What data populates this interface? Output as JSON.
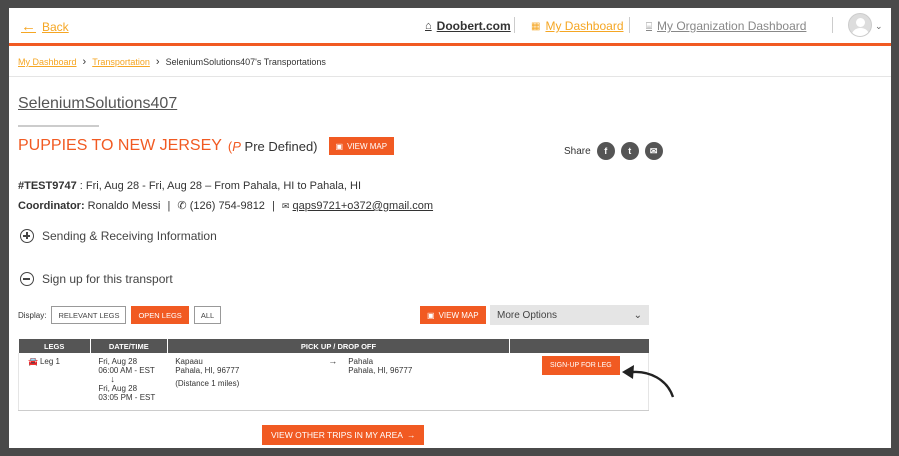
{
  "header": {
    "back_label": "Back",
    "doobert_label": "Doobert.com",
    "my_dashboard_label": "My Dashboard",
    "org_dashboard_label": "My Organization Dashboard"
  },
  "breadcrumb": {
    "items": [
      "My Dashboard",
      "Transportation"
    ],
    "current": "SeleniumSolutions407's Transportations"
  },
  "org": {
    "name": "SeleniumSolutions407"
  },
  "trip": {
    "title": "PUPPIES TO NEW JERSEY",
    "type_prefix": "(",
    "type_icon": "P",
    "type_label": " Pre Defined)",
    "view_map_label": "VIEW MAP",
    "share_label": "Share",
    "id": "#TEST9747",
    "summary": " : Fri, Aug 28 - Fri, Aug 28 – From Pahala, HI to Pahala, HI",
    "coordinator_label": "Coordinator:",
    "coordinator_name": " Ronaldo Messi",
    "phone": "(126) 754-9812",
    "email": "qaps9721+o372@gmail.com"
  },
  "sections": {
    "sending": "Sending & Receiving Information",
    "signup": "Sign up for this transport"
  },
  "filters": {
    "display_label": "Display:",
    "relevant": "RELEVANT LEGS",
    "open": "OPEN LEGS",
    "all": "ALL",
    "view_map_label": "VIEW MAP",
    "more_options": "More Options"
  },
  "table": {
    "headers": [
      "LEGS",
      "DATE/TIME",
      "PICK UP / DROP OFF",
      ""
    ],
    "rows": [
      {
        "leg": "Leg 1",
        "start_date": "Fri, Aug 28",
        "start_time": "06:00 AM - EST",
        "end_date": "Fri, Aug 28",
        "end_time": "03:05 PM - EST",
        "pickup_city": "Kapaau",
        "pickup_addr": "Pahala, HI, 96777",
        "distance": "(Distance 1 miles)",
        "dropoff_city": "Pahala",
        "dropoff_addr": "Pahala, HI, 96777",
        "signup_label": "SIGN-UP FOR LEG"
      }
    ]
  },
  "bottom_button": "VIEW OTHER TRIPS IN MY AREA",
  "colors": {
    "accent": "#f15a22",
    "gold": "#f5a623",
    "dark": "#555555"
  }
}
